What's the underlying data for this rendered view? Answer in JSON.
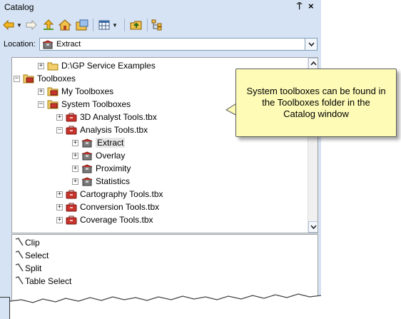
{
  "window": {
    "title": "Catalog",
    "pin_glyph": "⍑",
    "close_glyph": "×"
  },
  "toolbar": {
    "items": [
      {
        "name": "back-icon"
      },
      {
        "name": "forward-icon"
      },
      {
        "name": "up-one-level-icon"
      },
      {
        "name": "home-icon"
      },
      {
        "name": "toggle-contents-icon"
      },
      {
        "name": "view-options-icon"
      },
      {
        "name": "connect-folder-icon"
      },
      {
        "name": "catalog-tree-icon"
      }
    ]
  },
  "location": {
    "label": "Location:",
    "value": "Extract"
  },
  "tree": {
    "items": [
      {
        "label": "D:\\GP Service Examples",
        "expander": "+",
        "icon": "folder-icon"
      },
      {
        "label": "Toolboxes",
        "expander": "−",
        "icon": "toolboxes-folder-icon"
      },
      {
        "label": "My Toolboxes",
        "expander": "+",
        "icon": "toolboxes-folder-icon"
      },
      {
        "label": "System Toolboxes",
        "expander": "−",
        "icon": "toolboxes-folder-icon"
      },
      {
        "label": "3D Analyst Tools.tbx",
        "expander": "+",
        "icon": "toolbox-icon"
      },
      {
        "label": "Analysis Tools.tbx",
        "expander": "−",
        "icon": "toolbox-icon"
      },
      {
        "label": "Extract",
        "expander": "+",
        "icon": "toolset-icon",
        "selected": true
      },
      {
        "label": "Overlay",
        "expander": "+",
        "icon": "toolset-icon"
      },
      {
        "label": "Proximity",
        "expander": "+",
        "icon": "toolset-icon"
      },
      {
        "label": "Statistics",
        "expander": "+",
        "icon": "toolset-icon"
      },
      {
        "label": "Cartography Tools.tbx",
        "expander": "+",
        "icon": "toolbox-icon"
      },
      {
        "label": "Conversion Tools.tbx",
        "expander": "+",
        "icon": "toolbox-icon"
      },
      {
        "label": "Coverage Tools.tbx",
        "expander": "+",
        "icon": "toolbox-icon"
      }
    ]
  },
  "contents": {
    "items": [
      {
        "label": "Clip",
        "icon": "tool-hammer-icon"
      },
      {
        "label": "Select",
        "icon": "tool-hammer-icon"
      },
      {
        "label": "Split",
        "icon": "tool-hammer-icon"
      },
      {
        "label": "Table Select",
        "icon": "tool-hammer-icon"
      }
    ]
  },
  "callout": {
    "text": "System toolboxes can be found in the Toolboxes folder in the Catalog window"
  },
  "colors": {
    "window_bg": "#d6e3f4",
    "callout_bg": "#fdfbb6",
    "toolbox_red": "#c8332b"
  }
}
